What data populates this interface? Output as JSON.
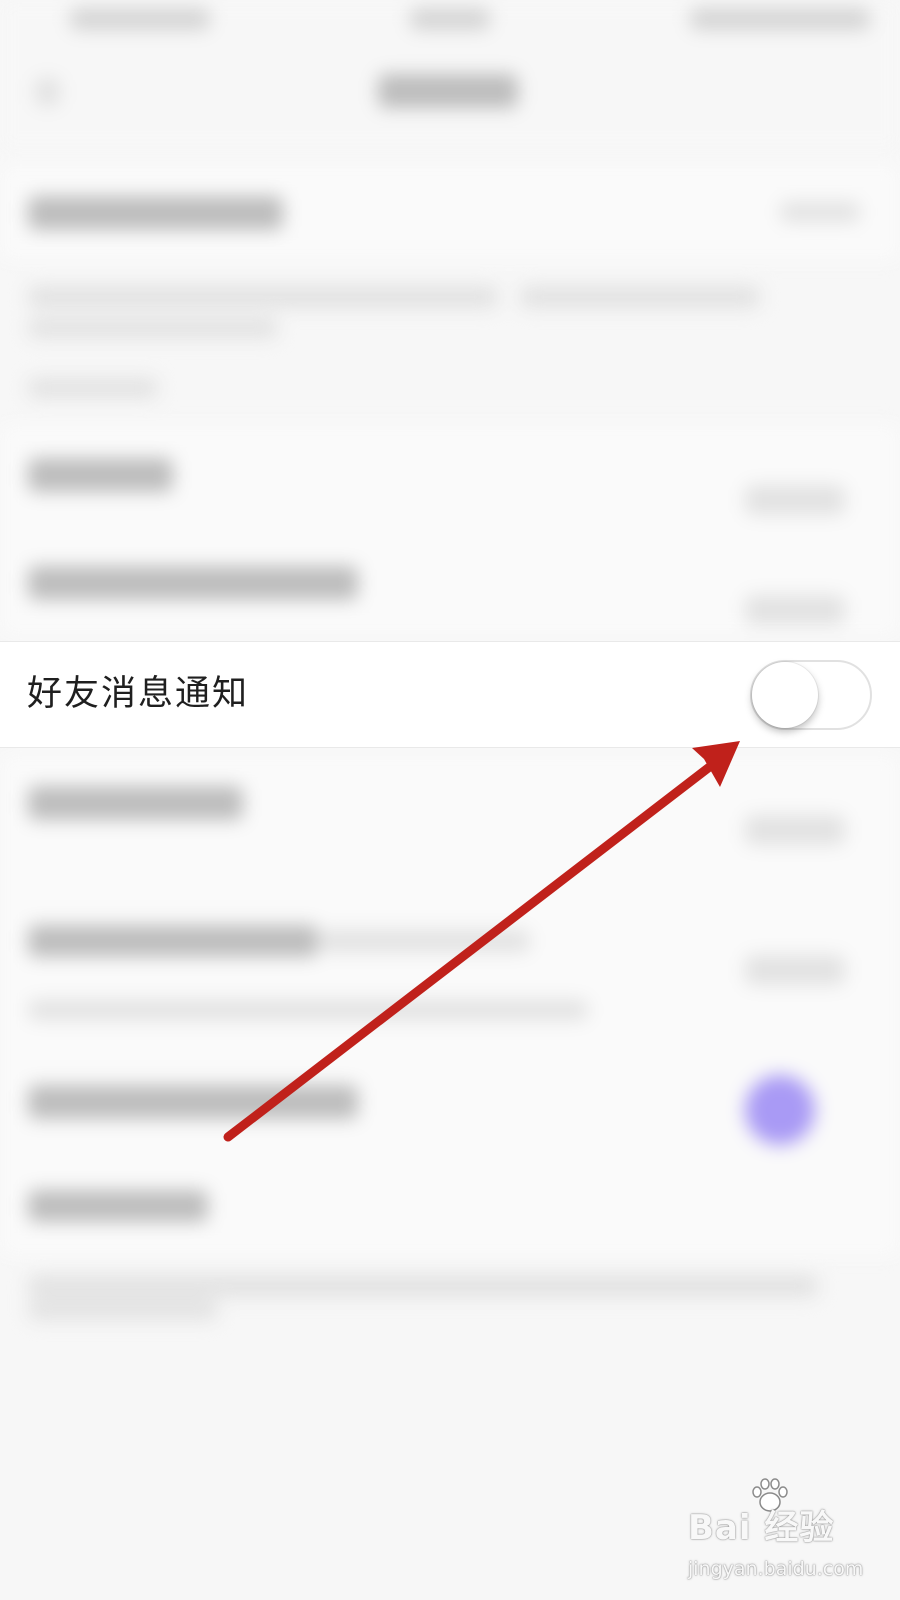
{
  "setting": {
    "label": "好友消息通知",
    "toggle_on": false
  },
  "watermark": {
    "brand": "Bai  经验",
    "sub": "jingyan.baidu.com"
  },
  "colors": {
    "arrow": "#c0211b",
    "purple_blob": "#a99af5",
    "background": "#f7f7f7"
  }
}
